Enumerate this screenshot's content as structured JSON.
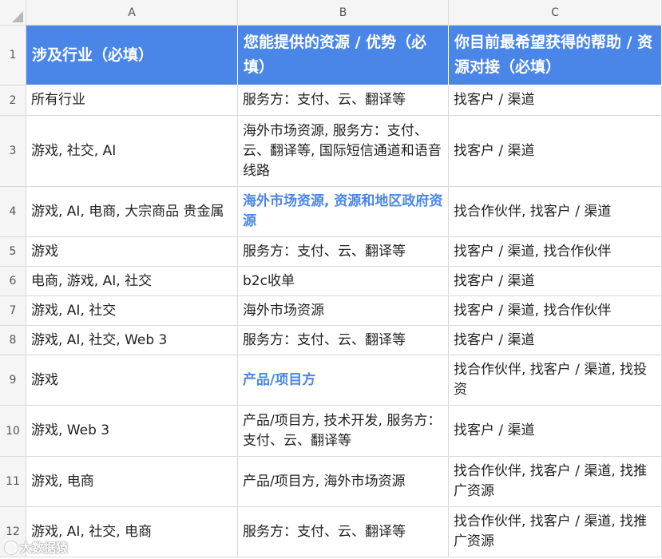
{
  "columns": [
    "A",
    "B",
    "C"
  ],
  "row_numbers": [
    "1",
    "2",
    "3",
    "4",
    "5",
    "6",
    "7",
    "8",
    "9",
    "10",
    "11",
    "12"
  ],
  "header": {
    "a": "涉及行业（必填）",
    "b": "您能提供的资源 / 优势（必填）",
    "c": "你目前最希望获得的帮助 / 资源对接（必填）",
    "fill_color": "#4a86e8"
  },
  "rows": [
    {
      "a": "所有行业",
      "b": "服务方：支付、云、翻译等",
      "c": "找客户 / 渠道"
    },
    {
      "a": "游戏, 社交, AI",
      "b": "海外市场资源, 服务方：支付、云、翻译等, 国际短信通道和语音线路",
      "c": "找客户 / 渠道"
    },
    {
      "a": "游戏, AI, 电商, 大宗商品 贵金属",
      "b": "海外市场资源, 资源和地区政府资源",
      "c": "找合作伙伴, 找客户 / 渠道"
    },
    {
      "a": "游戏",
      "b": "服务方：支付、云、翻译等",
      "c": "找客户 / 渠道, 找合作伙伴"
    },
    {
      "a": "电商, 游戏, AI, 社交",
      "b": "b2c收单",
      "c": "找客户 / 渠道"
    },
    {
      "a": "游戏, AI, 社交",
      "b": "海外市场资源",
      "c": "找客户 / 渠道, 找合作伙伴"
    },
    {
      "a": "游戏, AI, 社交, Web 3",
      "b": "服务方：支付、云、翻译等",
      "c": "找客户 / 渠道"
    },
    {
      "a": "游戏",
      "b": "产品/项目方",
      "c": "找合作伙伴, 找客户 / 渠道, 找投资"
    },
    {
      "a": "游戏, Web 3",
      "b": "产品/项目方, 技术开发, 服务方：支付、云、翻译等",
      "c": "找客户 / 渠道"
    },
    {
      "a": "游戏, 电商",
      "b": "产品/项目方, 海外市场资源",
      "c": "找合作伙伴, 找客户 / 渠道, 找推广资源"
    },
    {
      "a": "游戏, AI, 社交, 电商",
      "b": "服务方：支付、云、翻译等",
      "c": "找合作伙伴, 找客户 / 渠道, 找推广资源"
    }
  ],
  "highlight_color": "#4a86e8",
  "watermark": "大数据猿"
}
